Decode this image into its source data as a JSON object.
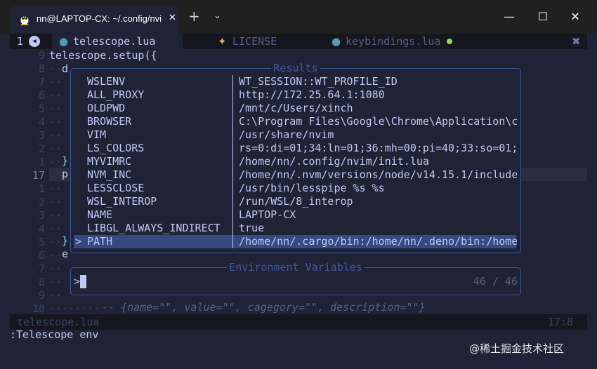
{
  "titlebar": {
    "tab_title": "nn@LAPTOP-CX: ~/.config/nvim",
    "close_tab": "✕",
    "new_tab": "+",
    "dropdown": "⌄",
    "minimize": "—",
    "maximize": "☐",
    "close": "✕"
  },
  "bufferline": {
    "buffer_number": "1",
    "back_arrow": "◀",
    "tabs": [
      {
        "icon": "lua-icon",
        "name": "telescope.lua",
        "active": true
      },
      {
        "icon": "license-icon",
        "name": "LICENSE",
        "active": false
      },
      {
        "icon": "lua-icon",
        "name": "keybindings.lua",
        "active": false,
        "modified": true
      }
    ],
    "close_all": "✖"
  },
  "editor": {
    "line_numbers": [
      "9",
      "8",
      "7",
      "6",
      "5",
      "4",
      "3",
      "2",
      "1",
      "17",
      "1",
      "2",
      "3",
      "4",
      "5",
      "6",
      "7",
      "8",
      "9",
      "10"
    ],
    "current_line_index": 9,
    "first_line_text": "telescope.setup({",
    "left_chars": [
      "d",
      "}",
      "p",
      "}",
      "e"
    ],
    "comment_line": "-- {name=\"\", value=\"\", cagegory=\"\", description=\"\"}"
  },
  "telescope": {
    "results_title": "Results",
    "prompt_title": "Environment Variables",
    "results": [
      {
        "key": "WSLENV",
        "value": "WT_SESSION::WT_PROFILE_ID"
      },
      {
        "key": "ALL_PROXY",
        "value": "http://172.25.64.1:1080"
      },
      {
        "key": "OLDPWD",
        "value": "/mnt/c/Users/xinch"
      },
      {
        "key": "BROWSER",
        "value": "C:\\Program Files\\Google\\Chrome\\Application\\c"
      },
      {
        "key": "VIM",
        "value": "/usr/share/nvim"
      },
      {
        "key": "LS_COLORS",
        "value": "rs=0:di=01;34:ln=01;36:mh=00:pi=40;33:so=01;"
      },
      {
        "key": "MYVIMRC",
        "value": "/home/nn/.config/nvim/init.lua"
      },
      {
        "key": "NVM_INC",
        "value": "/home/nn/.nvm/versions/node/v14.15.1/include"
      },
      {
        "key": "LESSCLOSE",
        "value": "/usr/bin/lesspipe %s %s"
      },
      {
        "key": "WSL_INTEROP",
        "value": "/run/WSL/8_interop"
      },
      {
        "key": "NAME",
        "value": "LAPTOP-CX"
      },
      {
        "key": "LIBGL_ALWAYS_INDIRECT",
        "value": "true"
      },
      {
        "key": "PATH",
        "value": "/home/nn/.cargo/bin:/home/nn/.deno/bin:/home",
        "selected": true
      }
    ],
    "selection_caret": ">",
    "prompt_prefix": ">",
    "prompt_value": "",
    "count": "46 / 46"
  },
  "statusline": {
    "file": "telescope.lua",
    "position": "17:8"
  },
  "cmdline": ":Telescope env",
  "watermark": "@稀土掘金技术社区",
  "colors": {
    "background": "#1f2335",
    "border": "#3d59a1",
    "selection": "#364a82",
    "foreground": "#c0caf5",
    "muted": "#565f89"
  }
}
